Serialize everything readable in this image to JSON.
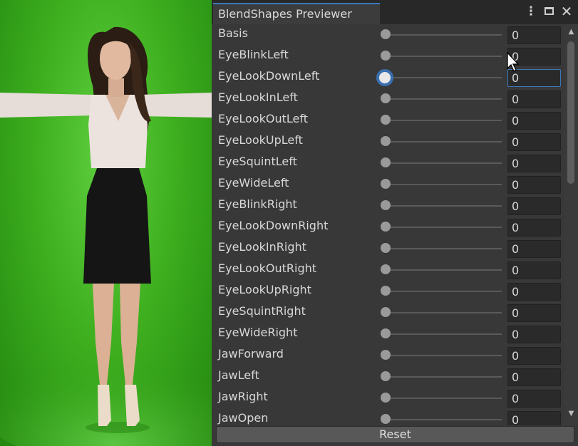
{
  "window": {
    "title": "BlendShapes Previewer",
    "more_icon": "more-vertical-icon",
    "maximize_icon": "maximize-icon",
    "close_icon": "close-icon"
  },
  "blendshapes": [
    {
      "label": "Basis",
      "value": "0"
    },
    {
      "label": "EyeBlinkLeft",
      "value": "0"
    },
    {
      "label": "EyeLookDownLeft",
      "value": "0"
    },
    {
      "label": "EyeLookInLeft",
      "value": "0"
    },
    {
      "label": "EyeLookOutLeft",
      "value": "0"
    },
    {
      "label": "EyeLookUpLeft",
      "value": "0"
    },
    {
      "label": "EyeSquintLeft",
      "value": "0"
    },
    {
      "label": "EyeWideLeft",
      "value": "0"
    },
    {
      "label": "EyeBlinkRight",
      "value": "0"
    },
    {
      "label": "EyeLookDownRight",
      "value": "0"
    },
    {
      "label": "EyeLookInRight",
      "value": "0"
    },
    {
      "label": "EyeLookOutRight",
      "value": "0"
    },
    {
      "label": "EyeLookUpRight",
      "value": "0"
    },
    {
      "label": "EyeSquintRight",
      "value": "0"
    },
    {
      "label": "EyeWideRight",
      "value": "0"
    },
    {
      "label": "JawForward",
      "value": "0"
    },
    {
      "label": "JawLeft",
      "value": "0"
    },
    {
      "label": "JawRight",
      "value": "0"
    },
    {
      "label": "JawOpen",
      "value": "0"
    }
  ],
  "active_row_index": 2,
  "reset_label": "Reset",
  "colors": {
    "accent": "#3a79bb",
    "green_screen": "#3fb01f",
    "panel_bg": "#383838"
  }
}
